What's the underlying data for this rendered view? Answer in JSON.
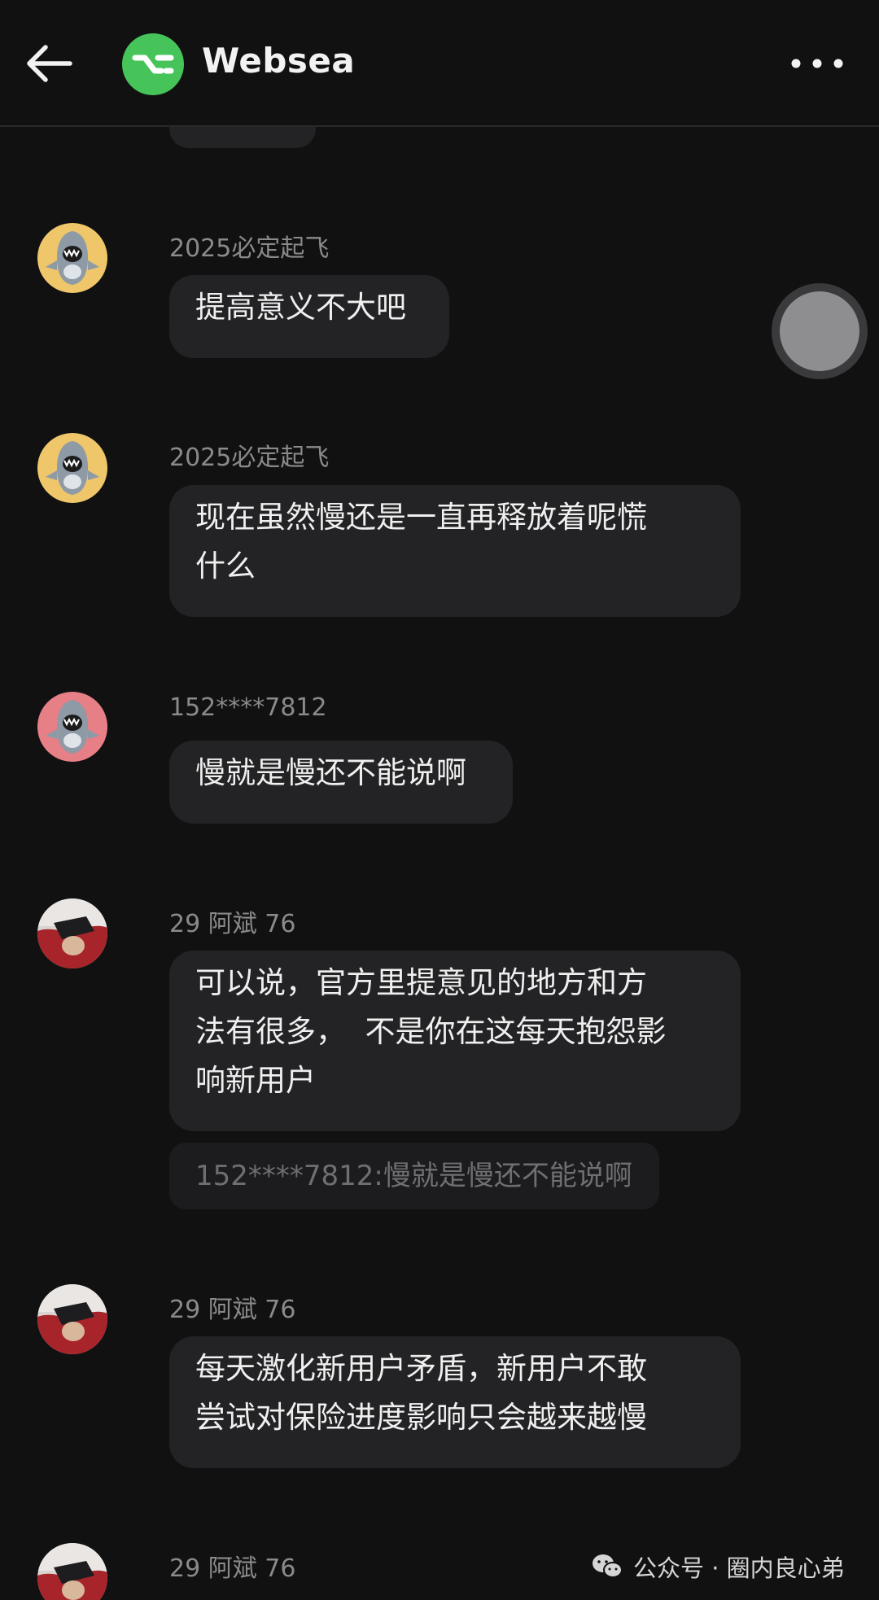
{
  "header": {
    "title": "Websea",
    "back_icon": "arrow-left-icon",
    "more_icon": "more-horizontal-icon",
    "logo_color": "#46c45a"
  },
  "messages": [
    {
      "sender": "2025必定起飞",
      "lines": [
        "提高意义不大吧"
      ],
      "avatar": "shark-avatar-yellow"
    },
    {
      "sender": "2025必定起飞",
      "lines": [
        "现在虽然慢还是一直再释放着呢慌",
        "什么"
      ],
      "avatar": "shark-avatar-yellow"
    },
    {
      "sender": "152****7812",
      "lines": [
        "慢就是慢还不能说啊"
      ],
      "avatar": "shark-avatar-pink"
    },
    {
      "sender": "29 阿斌 76",
      "lines": [
        "可以说，官方里提意见的地方和方",
        "法有很多，  不是你在这每天抱怨影",
        "响新用户"
      ],
      "quote": "152****7812:慢就是慢还不能说啊",
      "avatar": "photo-avatar"
    },
    {
      "sender": "29 阿斌 76",
      "lines": [
        "每天激化新用户矛盾，新用户不敢",
        "尝试对保险进度影响只会越来越慢"
      ],
      "avatar": "photo-avatar"
    },
    {
      "sender": "29 阿斌 76",
      "avatar": "photo-avatar"
    }
  ],
  "watermark": {
    "text": "公众号 · 圈内良心弟",
    "icon": "wechat-icon"
  },
  "colors": {
    "background": "#111112",
    "bubble": "#232325",
    "name": "#8a8a8c"
  }
}
